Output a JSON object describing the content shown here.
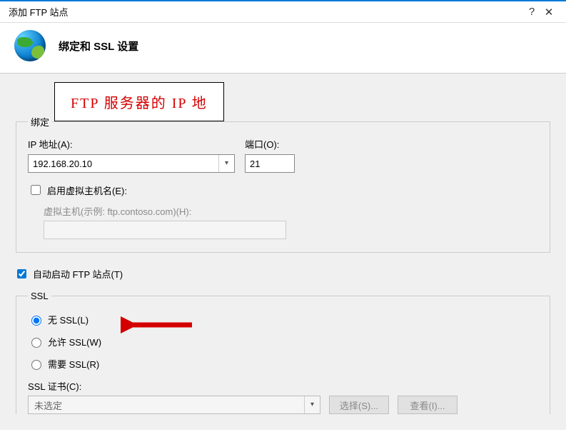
{
  "window": {
    "title": "添加 FTP 站点",
    "help": "?",
    "close": "✕"
  },
  "header": {
    "title": "绑定和 SSL 设置"
  },
  "annotation": "FTP 服务器的 IP 地",
  "binding": {
    "legend": "绑定",
    "ip_label": "IP 地址(A):",
    "ip_value": "192.168.20.10",
    "port_label": "端口(O):",
    "port_value": "21",
    "enable_vhost_label": "启用虚拟主机名(E):",
    "enable_vhost_checked": false,
    "vhost_label": "虚拟主机(示例: ftp.contoso.com)(H):",
    "vhost_value": ""
  },
  "autostart": {
    "label": "自动启动 FTP 站点(T)",
    "checked": true
  },
  "ssl": {
    "legend": "SSL",
    "options": [
      {
        "label": "无 SSL(L)",
        "value": "none",
        "checked": true
      },
      {
        "label": "允许 SSL(W)",
        "value": "allow",
        "checked": false
      },
      {
        "label": "需要 SSL(R)",
        "value": "require",
        "checked": false
      }
    ],
    "cert_label": "SSL 证书(C):",
    "cert_value": "未选定",
    "select_btn": "选择(S)...",
    "view_btn": "查看(I)..."
  }
}
